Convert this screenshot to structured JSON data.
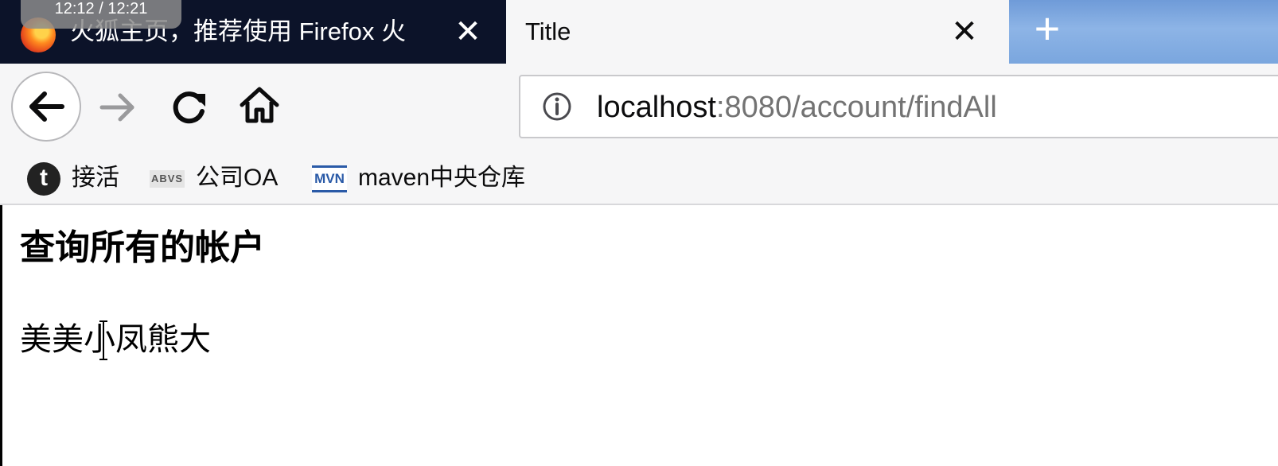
{
  "video_overlay": {
    "time": "12:12 / 12:21"
  },
  "tabs": [
    {
      "title": "火狐主页，推荐使用 Firefox 火",
      "close": "✕",
      "active": false
    },
    {
      "title": "Title",
      "close": "✕",
      "active": true
    }
  ],
  "new_tab": {
    "label": "+"
  },
  "url": {
    "host": "localhost",
    "rest": ":8080/account/findAll"
  },
  "bookmarks": [
    {
      "icon": "t-circle-icon",
      "icon_text": "t",
      "label": "接活"
    },
    {
      "icon": "abvs-icon",
      "icon_text": "ABVS",
      "label": "公司OA"
    },
    {
      "icon": "mvn-icon",
      "icon_text": "MVN",
      "label": "maven中央仓库"
    }
  ],
  "page": {
    "heading": "查询所有的帐户",
    "text": "美美小凤熊大"
  },
  "colors": {
    "tabstrip": "#0c1329",
    "active_tab": "#f6f6f7",
    "url_rest": "#737373",
    "mvn_blue": "#2a5aa7"
  }
}
